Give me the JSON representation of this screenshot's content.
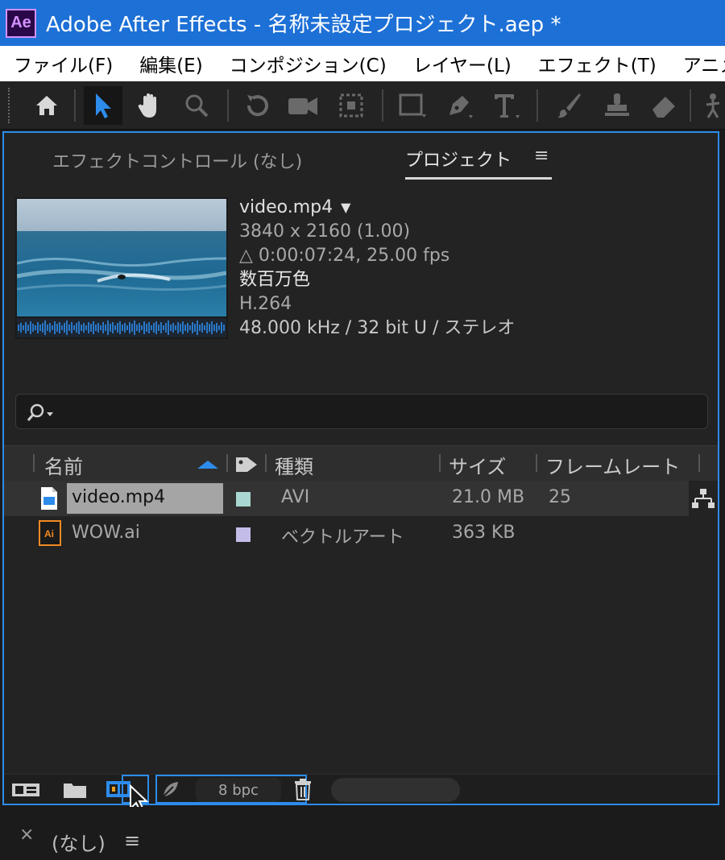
{
  "window": {
    "app_icon": "Ae",
    "title": "Adobe After Effects - 名称未設定プロジェクト.aep *"
  },
  "menu": [
    "ファイル(F)",
    "編集(E)",
    "コンポジション(C)",
    "レイヤー(L)",
    "エフェクト(T)",
    "アニメーシ"
  ],
  "toolbar": {
    "tools": [
      "home-icon",
      "selection-arrow-icon",
      "hand-icon",
      "zoom-icon",
      "rotate-icon",
      "camera-icon",
      "pan-behind-icon",
      "rectangle-icon",
      "pen-icon",
      "type-icon",
      "brush-icon",
      "clone-stamp-icon",
      "eraser-icon",
      "puppet-icon"
    ]
  },
  "panel": {
    "tab_effect": "エフェクトコントロール (なし)",
    "tab_project": "プロジェクト",
    "menu_glyph": "≡"
  },
  "preview": {
    "name": "video.mp4",
    "dropdown": "▼",
    "resolution": "3840 x 2160 (1.00)",
    "duration": "△ 0:00:07:24, 25.00 fps",
    "colors": "数百万色",
    "codec": "H.264",
    "audio": "48.000 kHz / 32 bit U / ステレオ"
  },
  "search": {
    "icon": "search-icon"
  },
  "columns": {
    "name": "名前",
    "label_icon": "tag-icon",
    "type": "種類",
    "size": "サイズ",
    "frame_rate": "フレームレート"
  },
  "rows": [
    {
      "name": "video.mp4",
      "type": "AVI",
      "size": "21.0 MB",
      "fps": "25",
      "label_color": "#a9d8d0",
      "icon": "video-file-icon"
    },
    {
      "name": "WOW.ai",
      "type": "ベクトルアート",
      "size": "363 KB",
      "fps": "",
      "label_color": "#c4bce8",
      "icon": "illustrator-file-icon"
    }
  ],
  "bottombar": {
    "bpc": "8 bpc"
  },
  "bottom_tab": {
    "close": "×",
    "label": "(なし)",
    "menu": "≡"
  },
  "colors": {
    "accent": "#2d8ceb",
    "titlebar": "#1d70d6",
    "panel_bg": "#232323"
  }
}
